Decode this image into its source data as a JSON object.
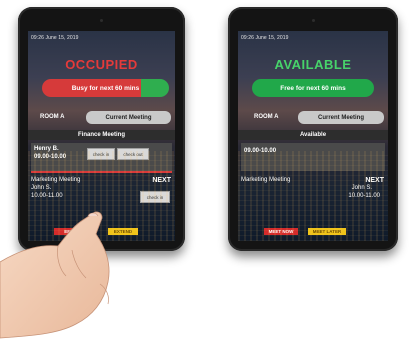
{
  "left_tablet": {
    "datetime": "09:26 June 15, 2019",
    "status": "OCCUPIED",
    "banner": "Busy for next 60 mins",
    "room": "ROOM A",
    "current_button": "Current Meeting",
    "meeting_title": "Finance Meeting",
    "host": "Henry B.",
    "time_range": "09.00-10.00",
    "check_in": "check in",
    "check_out": "check out",
    "next_title": "Marketing Meeting",
    "next_label": "NEXT",
    "next_host": "John S.",
    "next_time": "10.00-11.00",
    "next_check_in": "check in",
    "end_button": "END",
    "extend_button": "EXTEND"
  },
  "right_tablet": {
    "datetime": "09:26 June 15, 2019",
    "status": "AVAILABLE",
    "banner": "Free for next 60 mins",
    "room": "ROOM A",
    "current_button": "Current Meeting",
    "available_label": "Available",
    "time_range": "09.00-10.00",
    "next_title": "Marketing Meeting",
    "next_label": "NEXT",
    "next_host": "John S.",
    "next_time": "10.00-11.00",
    "meet_now": "MEET NOW",
    "meet_later": "MEET LATER"
  },
  "colors": {
    "occupied": "#e53a3a",
    "available": "#47d36a",
    "banner_red": "#d63a3a",
    "banner_green": "#21a84a",
    "footer_yellow": "#f0c419",
    "footer_red": "#d42b2b"
  }
}
